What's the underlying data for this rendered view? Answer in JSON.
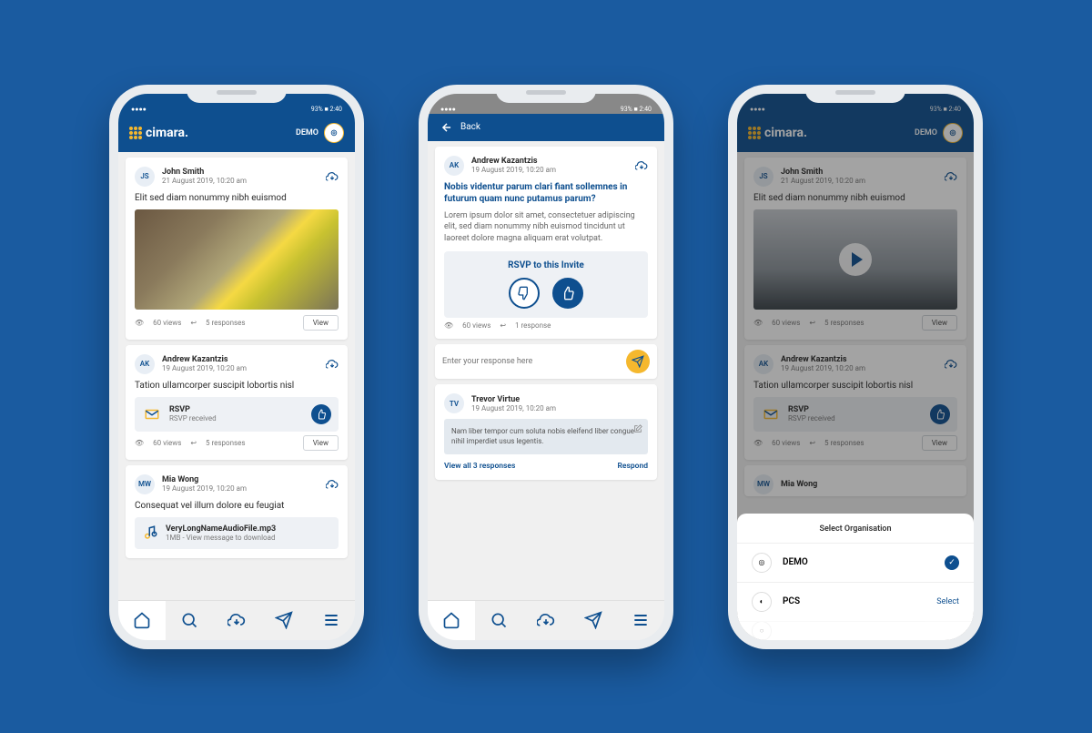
{
  "common": {
    "brand": "cimara.",
    "demo_label": "DEMO",
    "status_left": "●●●●",
    "status_right": "93% ■ 2:40",
    "nav": [
      "home",
      "search",
      "cloud",
      "send",
      "menu"
    ]
  },
  "feed": {
    "posts": [
      {
        "initials": "JS",
        "name": "John Smith",
        "date": "21 August 2019, 10:20 am",
        "title": "Elit sed diam nonummy nibh euismod",
        "views": "60 views",
        "responses": "5 responses",
        "view_btn": "View"
      },
      {
        "initials": "AK",
        "name": "Andrew Kazantzis",
        "date": "19 August 2019, 10:20 am",
        "title": "Tation ullamcorper suscipit lobortis nisl",
        "rsvp_label": "RSVP",
        "rsvp_status": "RSVP received",
        "views": "60 views",
        "responses": "5 responses",
        "view_btn": "View"
      },
      {
        "initials": "MW",
        "name": "Mia Wong",
        "date": "19 August 2019, 10:20 am",
        "title": "Consequat vel illum dolore eu feugiat",
        "file_name": "VeryLongNameAudioFile.mp3",
        "file_meta": "1MB - View message to download"
      }
    ]
  },
  "detail": {
    "back": "Back",
    "post": {
      "initials": "AK",
      "name": "Andrew Kazantzis",
      "date": "19 August 2019, 10:20 am",
      "title": "Nobis videntur parum clari fiant sollemnes in futurum quam nunc putamus parum?",
      "body": "Lorem ipsum dolor sit amet, consectetuer adipiscing elit, sed diam nonummy nibh euismod tincidunt ut laoreet dolore magna aliquam erat volutpat.",
      "rsvp_title": "RSVP to this Invite",
      "views": "60 views",
      "responses": "1 response"
    },
    "input_placeholder": "Enter your response here",
    "response": {
      "initials": "TV",
      "name": "Trevor Virtue",
      "date": "19 August 2019, 10:20 am",
      "text": "Nam liber tempor cum soluta nobis eleifend liber congue nihil imperdiet usus legentis."
    },
    "view_all": "View all 3 responses",
    "respond": "Respond"
  },
  "orgsheet": {
    "title": "Select Organisation",
    "orgs": [
      {
        "name": "DEMO",
        "selected": true
      },
      {
        "name": "PCS",
        "selected": false,
        "action": "Select"
      }
    ]
  }
}
